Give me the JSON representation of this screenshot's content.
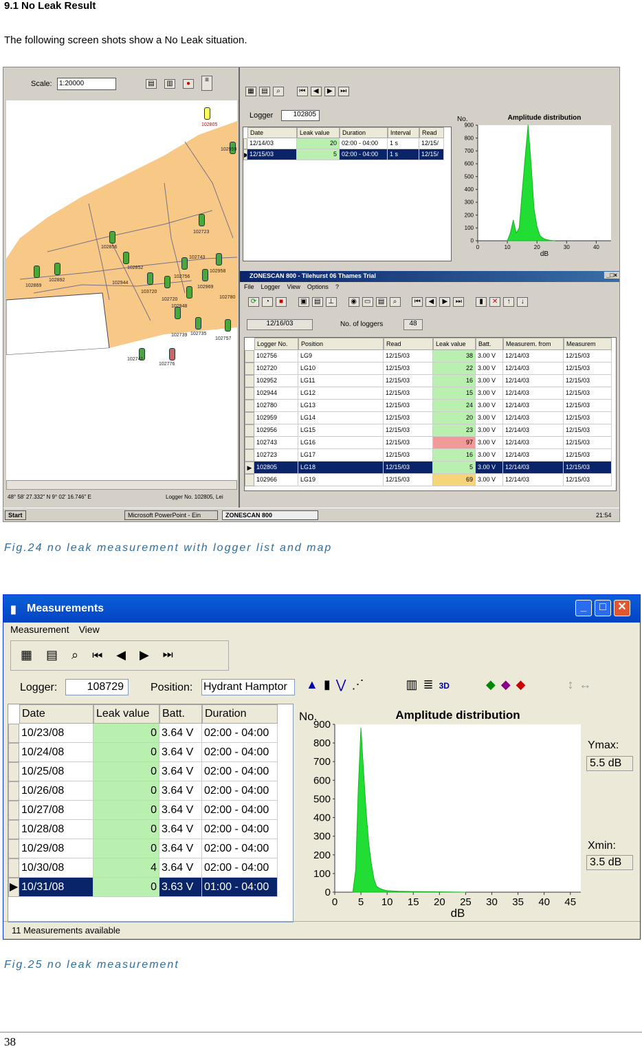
{
  "heading": "9.1 No Leak Result",
  "intro": "The following screen shots show a No Leak situation.",
  "fig24": {
    "caption": "Fig.24 no leak measurement with logger list and map",
    "map": {
      "scale_label": "Scale:",
      "scale_value": "1:20000",
      "coords": "48° 58' 27.332\" N   9° 02' 16.746\" E",
      "logger_no": "Logger No. 102805, Lei",
      "labels": [
        "102805",
        "102959",
        "102723",
        "102856",
        "102743",
        "102852",
        "102892",
        "102958",
        "102869",
        "102944",
        "102756",
        "102969",
        "102780",
        "103720",
        "102720",
        "102948",
        "102741",
        "102776",
        "102739",
        "102735",
        "102757",
        "102780"
      ]
    },
    "top": {
      "logger_label": "Logger",
      "logger_value": "102805",
      "cols": [
        "Date",
        "Leak value",
        "Duration",
        "Interval",
        "Read"
      ],
      "rows": [
        [
          "12/14/03",
          "20",
          "02:00 - 04:00",
          "1 s",
          "12/15/"
        ],
        [
          "12/15/03",
          "5",
          "02:00 - 04:00",
          "1 s",
          "12/15/"
        ]
      ]
    },
    "chart": {
      "title": "Amplitude distribution",
      "ylabel": "No.",
      "xlabel": "dB"
    },
    "window_title": "ZONESCAN 800 - Tilehurst 06 Thames Trial",
    "menu": [
      "File",
      "Logger",
      "View",
      "Options",
      "?"
    ],
    "date": "12/16/03",
    "num_loggers_label": "No. of loggers",
    "num_loggers": "48",
    "list_cols": [
      "Logger No.",
      "Position",
      "Read",
      "Leak value",
      "Batt.",
      "Measurem. from",
      "Measurem"
    ],
    "list_rows": [
      [
        "102756",
        "LG9",
        "12/15/03",
        "38",
        "3.00 V",
        "12/14/03",
        "12/15/03"
      ],
      [
        "102720",
        "LG10",
        "12/15/03",
        "22",
        "3.00 V",
        "12/14/03",
        "12/15/03"
      ],
      [
        "102952",
        "LG11",
        "12/15/03",
        "16",
        "3.00 V",
        "12/14/03",
        "12/15/03"
      ],
      [
        "102944",
        "LG12",
        "12/15/03",
        "15",
        "3.00 V",
        "12/14/03",
        "12/15/03"
      ],
      [
        "102780",
        "LG13",
        "12/15/03",
        "24",
        "3.00 V",
        "12/14/03",
        "12/15/03"
      ],
      [
        "102959",
        "LG14",
        "12/15/03",
        "20",
        "3.00 V",
        "12/14/03",
        "12/15/03"
      ],
      [
        "102956",
        "LG15",
        "12/15/03",
        "23",
        "3.00 V",
        "12/14/03",
        "12/15/03"
      ],
      [
        "102743",
        "LG16",
        "12/15/03",
        "97",
        "3.00 V",
        "12/14/03",
        "12/15/03"
      ],
      [
        "102723",
        "LG17",
        "12/15/03",
        "16",
        "3.00 V",
        "12/14/03",
        "12/15/03"
      ],
      [
        "102805",
        "LG18",
        "12/15/03",
        "5",
        "3.00 V",
        "12/14/03",
        "12/15/03"
      ],
      [
        "102966",
        "LG19",
        "12/15/03",
        "69",
        "3.00 V",
        "12/14/03",
        "12/15/03"
      ]
    ],
    "taskbar": {
      "start": "Start",
      "ppt": "Microsoft PowerPoint - Ein",
      "zonescan": "ZONESCAN 800",
      "clock": "21:54"
    }
  },
  "fig25": {
    "caption": "Fig.25 no leak measurement",
    "title": "Measurements",
    "menu": [
      "Measurement",
      "View"
    ],
    "logger_label": "Logger:",
    "logger_value": "108729",
    "position_label": "Position:",
    "position_value": "Hydrant Hamptor",
    "cols": [
      "Date",
      "Leak value",
      "Batt.",
      "Duration"
    ],
    "rows": [
      [
        "10/23/08",
        "0",
        "3.64 V",
        "02:00 - 04:00"
      ],
      [
        "10/24/08",
        "0",
        "3.64 V",
        "02:00 - 04:00"
      ],
      [
        "10/25/08",
        "0",
        "3.64 V",
        "02:00 - 04:00"
      ],
      [
        "10/26/08",
        "0",
        "3.64 V",
        "02:00 - 04:00"
      ],
      [
        "10/27/08",
        "0",
        "3.64 V",
        "02:00 - 04:00"
      ],
      [
        "10/28/08",
        "0",
        "3.64 V",
        "02:00 - 04:00"
      ],
      [
        "10/29/08",
        "0",
        "3.64 V",
        "02:00 - 04:00"
      ],
      [
        "10/30/08",
        "4",
        "3.64 V",
        "02:00 - 04:00"
      ],
      [
        "10/31/08",
        "0",
        "3.63 V",
        "01:00 - 04:00"
      ]
    ],
    "status": "11 Measurements available",
    "ymax_label": "Ymax:",
    "ymax_value": "5.5 dB",
    "xmin_label": "Xmin:",
    "xmin_value": "3.5 dB"
  },
  "page_number": "38",
  "chart_data": [
    {
      "type": "area",
      "title": "Amplitude distribution",
      "xlabel": "dB",
      "ylabel": "No.",
      "xlim": [
        0,
        45
      ],
      "ylim": [
        0,
        900
      ],
      "yticks": [
        0,
        100,
        200,
        300,
        400,
        500,
        600,
        700,
        800,
        900
      ],
      "xticks": [
        0,
        10,
        20,
        30,
        40
      ],
      "x": [
        10,
        11,
        12,
        13,
        14,
        15,
        16,
        17,
        18,
        19,
        20,
        21,
        22,
        23,
        24,
        25,
        26
      ],
      "series": [
        {
          "values": [
            0,
            60,
            160,
            60,
            100,
            380,
            650,
            900,
            600,
            250,
            110,
            40,
            20,
            10,
            5,
            2,
            0
          ]
        }
      ]
    },
    {
      "type": "area",
      "title": "Amplitude distribution",
      "xlabel": "dB",
      "ylabel": "No.",
      "xlim": [
        0,
        47
      ],
      "ylim": [
        0,
        900
      ],
      "yticks": [
        0,
        100,
        200,
        300,
        400,
        500,
        600,
        700,
        800,
        900
      ],
      "xticks": [
        0,
        5,
        10,
        15,
        20,
        25,
        30,
        35,
        40,
        45
      ],
      "x": [
        3.5,
        4,
        4.5,
        5,
        5.5,
        6,
        6.5,
        7,
        7.5,
        8,
        9,
        10,
        12,
        15,
        20,
        25
      ],
      "series": [
        {
          "values": [
            10,
            120,
            560,
            880,
            650,
            430,
            260,
            150,
            70,
            30,
            15,
            8,
            5,
            3,
            2,
            0
          ]
        }
      ]
    }
  ]
}
